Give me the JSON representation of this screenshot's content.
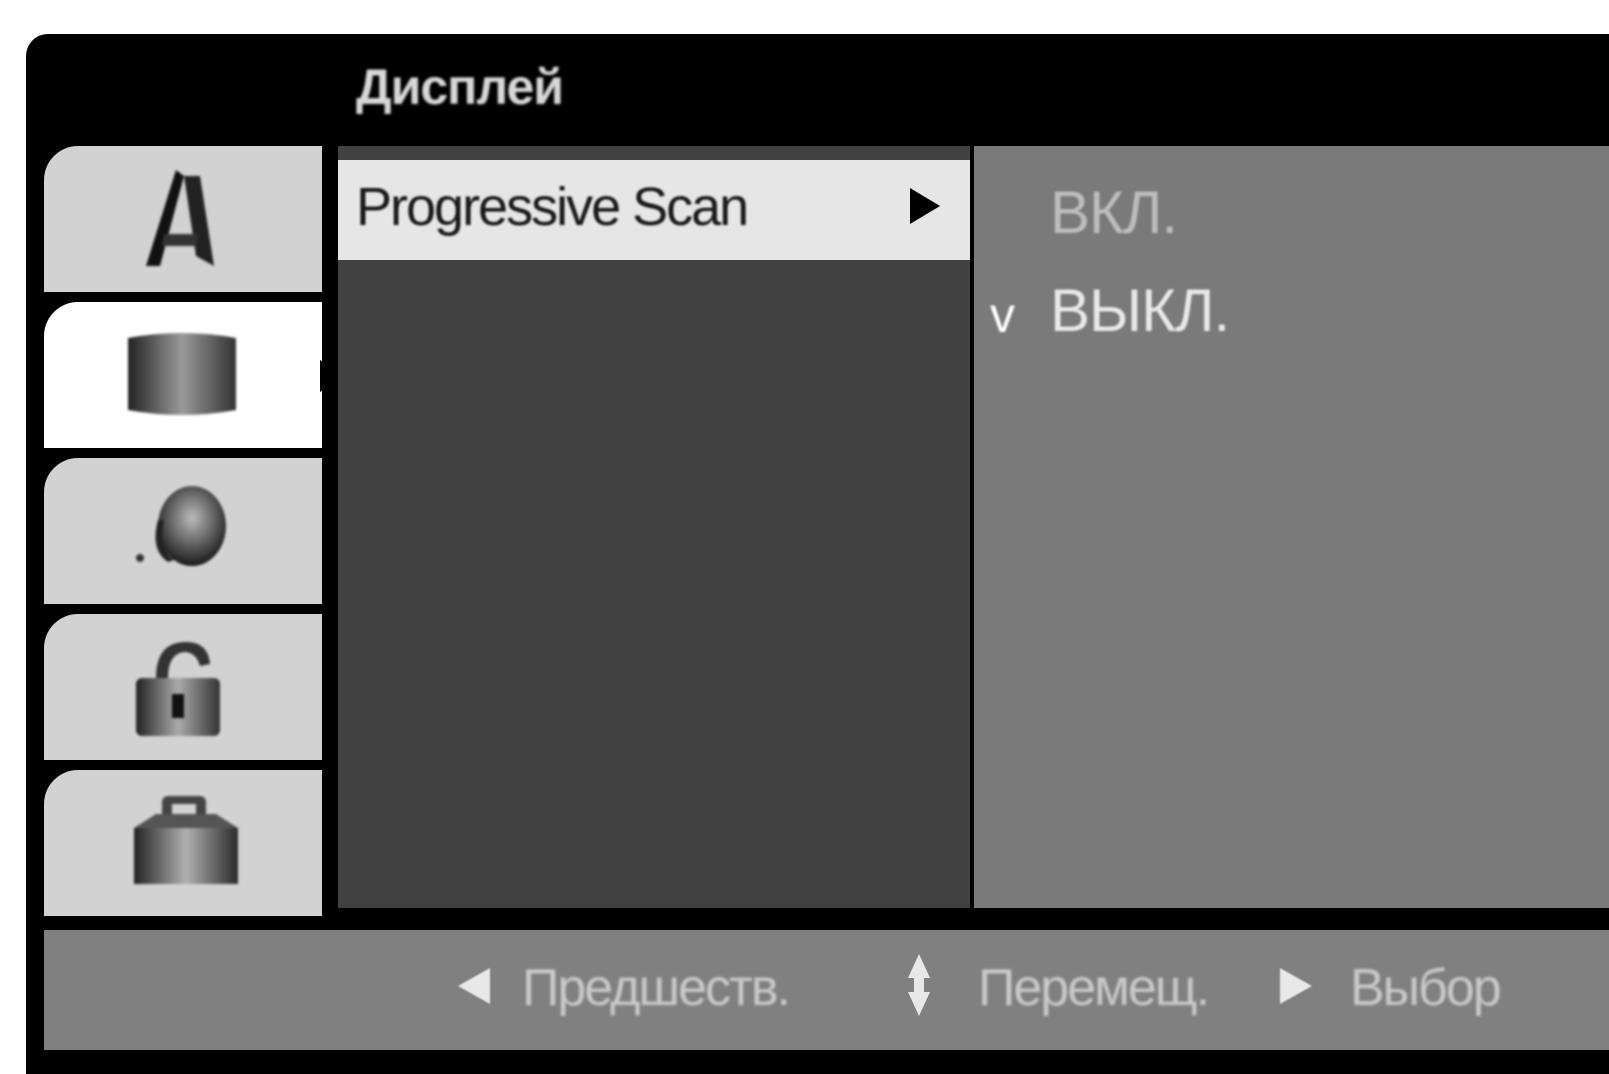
{
  "menu": {
    "title": "Дисплей"
  },
  "sidebar": {
    "tabs": [
      {
        "icon": "language-icon",
        "active": false
      },
      {
        "icon": "display-icon",
        "active": true
      },
      {
        "icon": "audio-icon",
        "active": false
      },
      {
        "icon": "lock-icon",
        "active": false
      },
      {
        "icon": "others-icon",
        "active": false
      }
    ]
  },
  "options": {
    "items": [
      {
        "label": "Progressive Scan",
        "selected": true
      }
    ]
  },
  "values": {
    "items": [
      {
        "label": "ВКЛ.",
        "checked": false
      },
      {
        "label": "ВЫКЛ.",
        "checked": true
      }
    ],
    "check_glyph": "v"
  },
  "help_bar": {
    "prev_label": "Предшеств.",
    "move_label": "Перемещ.",
    "select_label": "Выбор"
  },
  "colors": {
    "frame": "#000000",
    "options_panel": "#414141",
    "values_panel": "#7a7a7a",
    "highlight_row": "#e6e6e6",
    "help_bar": "#808080"
  }
}
